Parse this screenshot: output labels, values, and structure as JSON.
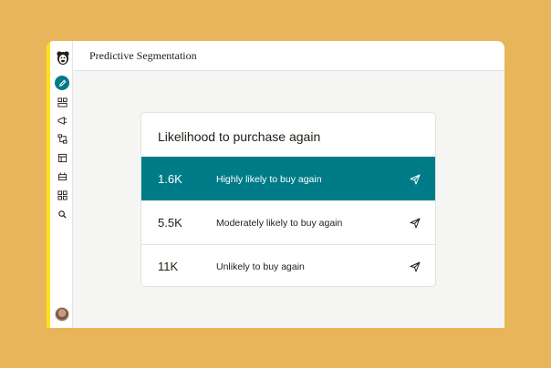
{
  "header": {
    "title": "Predictive Segmentation"
  },
  "sidebar": {
    "items": [
      {
        "icon": "pencil-icon",
        "active": true
      },
      {
        "icon": "audience-icon"
      },
      {
        "icon": "campaign-icon"
      },
      {
        "icon": "automation-icon"
      },
      {
        "icon": "content-icon"
      },
      {
        "icon": "integrations-icon"
      },
      {
        "icon": "grid-icon"
      },
      {
        "icon": "search-icon"
      }
    ]
  },
  "card": {
    "title": "Likelihood to purchase again",
    "rows": [
      {
        "count": "1.6K",
        "label": "Highly likely to buy again",
        "active": true
      },
      {
        "count": "5.5K",
        "label": "Moderately likely to buy again",
        "active": false
      },
      {
        "count": "11K",
        "label": "Unlikely to buy again",
        "active": false
      }
    ]
  },
  "colors": {
    "background": "#e8b55a",
    "accent": "#007c89",
    "brand_yellow": "#ffe01b"
  }
}
